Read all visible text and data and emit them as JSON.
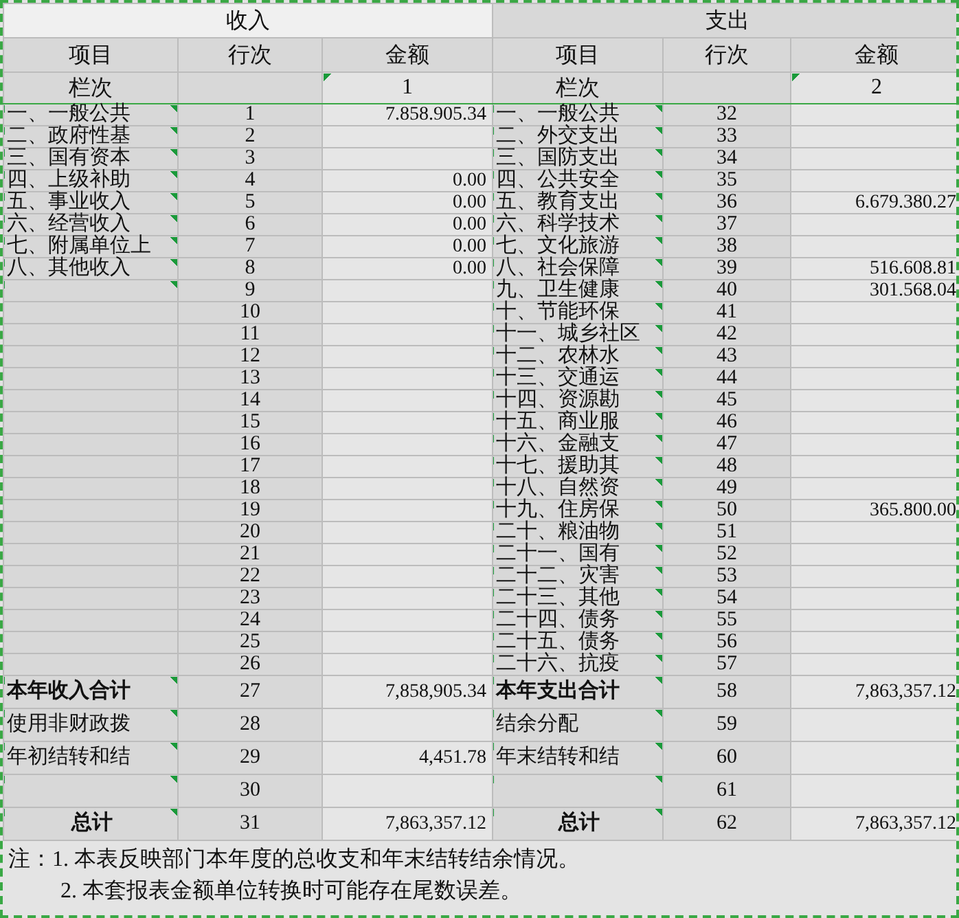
{
  "sections": [
    {
      "title": "收入"
    },
    {
      "title": "支出"
    }
  ],
  "columns": [
    "项目",
    "行次",
    "金额",
    "项目",
    "行次",
    "金额"
  ],
  "column_numbers": [
    {
      "label": "栏次",
      "number": "1",
      "flag": true
    },
    {
      "label": "栏次",
      "number": "2",
      "flag": true
    }
  ],
  "rows": [
    {
      "kind": "detail",
      "income": {
        "item": "一、一般公共",
        "line": "1",
        "amount": "7.858.905.34",
        "flag": true
      },
      "expense": {
        "item": "一、一般公共",
        "line": "32",
        "flag": true
      }
    },
    {
      "kind": "detail",
      "income": {
        "item": "二、政府性基",
        "line": "2",
        "flag": true
      },
      "expense": {
        "item": "二、外交支出",
        "line": "33",
        "flag": true
      }
    },
    {
      "kind": "detail",
      "income": {
        "item": "三、国有资本",
        "line": "3",
        "flag": true
      },
      "expense": {
        "item": "三、国防支出",
        "line": "34",
        "flag": true
      }
    },
    {
      "kind": "detail",
      "income": {
        "item": "四、上级补助",
        "line": "4",
        "amount": "0.00",
        "flag": true
      },
      "expense": {
        "item": "四、公共安全",
        "line": "35",
        "flag": true
      }
    },
    {
      "kind": "detail",
      "income": {
        "item": "五、事业收入",
        "line": "5",
        "amount": "0.00",
        "flag": true
      },
      "expense": {
        "item": "五、教育支出",
        "line": "36",
        "amount": "6.679.380.27",
        "flag": true
      }
    },
    {
      "kind": "detail",
      "income": {
        "item": "六、经营收入",
        "line": "6",
        "amount": "0.00",
        "flag": true
      },
      "expense": {
        "item": "六、科学技术",
        "line": "37",
        "flag": true
      }
    },
    {
      "kind": "detail",
      "income": {
        "item": "七、附属单位上",
        "line": "7",
        "amount": "0.00",
        "flag": true
      },
      "expense": {
        "item": "七、文化旅游",
        "line": "38",
        "flag": true
      }
    },
    {
      "kind": "detail",
      "income": {
        "item": "八、其他收入",
        "line": "8",
        "amount": "0.00",
        "flag": true
      },
      "expense": {
        "item": "八、社会保障",
        "line": "39",
        "amount": "516.608.81",
        "flag": true
      }
    },
    {
      "kind": "detail",
      "income": {
        "line": "9",
        "flag": true
      },
      "expense": {
        "item": "九、卫生健康",
        "line": "40",
        "amount": "301.568.04",
        "flag": true
      }
    },
    {
      "kind": "detail",
      "income": {
        "line": "10",
        "flag": false
      },
      "expense": {
        "item": "十、节能环保",
        "line": "41",
        "flag": true
      }
    },
    {
      "kind": "detail",
      "income": {
        "line": "11",
        "flag": false
      },
      "expense": {
        "item": "十一、城乡社区",
        "line": "42",
        "flag": true
      }
    },
    {
      "kind": "detail",
      "income": {
        "line": "12",
        "flag": false
      },
      "expense": {
        "item": "十二、农林水",
        "line": "43",
        "flag": true
      }
    },
    {
      "kind": "detail",
      "income": {
        "line": "13",
        "flag": false
      },
      "expense": {
        "item": "十三、交通运",
        "line": "44",
        "flag": true
      }
    },
    {
      "kind": "detail",
      "income": {
        "line": "14",
        "flag": false
      },
      "expense": {
        "item": "十四、资源勘",
        "line": "45",
        "flag": true
      }
    },
    {
      "kind": "detail",
      "income": {
        "line": "15",
        "flag": false
      },
      "expense": {
        "item": "十五、商业服",
        "line": "46",
        "flag": true
      }
    },
    {
      "kind": "detail",
      "income": {
        "line": "16",
        "flag": false
      },
      "expense": {
        "item": "十六、金融支",
        "line": "47",
        "flag": true
      }
    },
    {
      "kind": "detail",
      "income": {
        "line": "17",
        "flag": false
      },
      "expense": {
        "item": "十七、援助其",
        "line": "48",
        "flag": true
      }
    },
    {
      "kind": "detail",
      "income": {
        "line": "18",
        "flag": false
      },
      "expense": {
        "item": "十八、自然资",
        "line": "49",
        "flag": true
      }
    },
    {
      "kind": "detail",
      "income": {
        "line": "19",
        "flag": false
      },
      "expense": {
        "item": "十九、住房保",
        "line": "50",
        "amount": "365.800.00",
        "flag": true
      }
    },
    {
      "kind": "detail",
      "income": {
        "line": "20",
        "flag": false
      },
      "expense": {
        "item": "二十、粮油物",
        "line": "51",
        "flag": true
      }
    },
    {
      "kind": "detail",
      "income": {
        "line": "21",
        "flag": false
      },
      "expense": {
        "item": "二十一、国有",
        "line": "52",
        "flag": true
      }
    },
    {
      "kind": "detail",
      "income": {
        "line": "22",
        "flag": false
      },
      "expense": {
        "item": "二十二、灾害",
        "line": "53",
        "flag": true
      }
    },
    {
      "kind": "detail",
      "income": {
        "line": "23",
        "flag": false
      },
      "expense": {
        "item": "二十三、其他",
        "line": "54",
        "flag": true
      }
    },
    {
      "kind": "detail",
      "income": {
        "line": "24",
        "flag": false
      },
      "expense": {
        "item": "二十四、债务",
        "line": "55",
        "flag": true
      }
    },
    {
      "kind": "detail",
      "income": {
        "line": "25",
        "flag": false
      },
      "expense": {
        "item": "二十五、债务",
        "line": "56",
        "flag": true
      }
    },
    {
      "kind": "detail",
      "income": {
        "line": "26",
        "flag": false
      },
      "expense": {
        "item": "二十六、抗疫",
        "line": "57",
        "flag": true
      }
    },
    {
      "kind": "subtotal",
      "income": {
        "item": "本年收入合计",
        "line": "27",
        "amount": "7,858,905.34",
        "flag": true
      },
      "expense": {
        "item": "本年支出合计",
        "line": "58",
        "amount": "7,863,357.12",
        "flag": true
      }
    },
    {
      "kind": "plain",
      "income": {
        "item": "使用非财政拨",
        "line": "28",
        "flag": true
      },
      "expense": {
        "item": "结余分配",
        "line": "59",
        "flag": true
      }
    },
    {
      "kind": "plain",
      "income": {
        "item": "年初结转和结",
        "line": "29",
        "amount": "4,451.78",
        "flag": true
      },
      "expense": {
        "item": "年末结转和结",
        "line": "60",
        "flag": true
      }
    },
    {
      "kind": "plain",
      "income": {
        "line": "30",
        "flag": true
      },
      "expense": {
        "line": "61",
        "flag": true
      }
    },
    {
      "kind": "grand",
      "income": {
        "item": "总计",
        "line": "31",
        "amount": "7,863,357.12",
        "flag": true
      },
      "expense": {
        "item": "总计",
        "line": "62",
        "amount": "7,863,357.12",
        "flag": true
      }
    }
  ],
  "notes": [
    "注：1. 本表反映部门本年度的总收支和年末结转结余情况。",
    "2. 本套报表金额单位转换时可能存在尾数误差。"
  ]
}
